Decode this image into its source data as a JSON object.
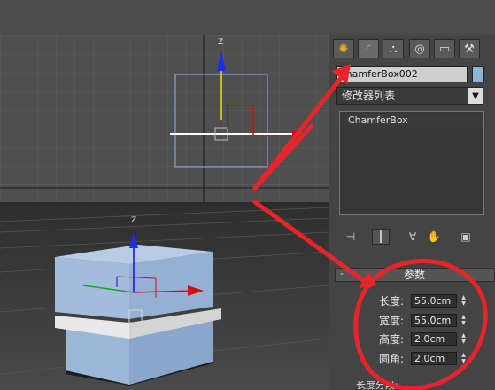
{
  "command_panel": {
    "tabs": [
      {
        "name": "create",
        "icon": "sun-icon",
        "glyph": "✺"
      },
      {
        "name": "modify",
        "icon": "modify-arc-icon",
        "glyph": "◜"
      },
      {
        "name": "hierarchy",
        "icon": "hierarchy-icon",
        "glyph": "⛬"
      },
      {
        "name": "motion",
        "icon": "motion-icon",
        "glyph": "◎"
      },
      {
        "name": "display",
        "icon": "display-icon",
        "glyph": "▭"
      },
      {
        "name": "utilities",
        "icon": "hammer-icon",
        "glyph": "⚒"
      }
    ],
    "object_name": "ChamferBox002",
    "object_color": "#8fb4d8",
    "modifier_list_label": "修改器列表",
    "modifier_stack": [
      "ChamferBox"
    ],
    "stack_tool_glyphs": [
      "⊣",
      "┃",
      "∀",
      "✋",
      "▣"
    ]
  },
  "parameters": {
    "title": "参数",
    "collapse_glyph": "-",
    "fields": [
      {
        "label": "长度:",
        "value": "55.0cm"
      },
      {
        "label": "宽度:",
        "value": "55.0cm"
      },
      {
        "label": "高度:",
        "value": "2.0cm"
      },
      {
        "label": "圆角:",
        "value": "2.0cm"
      }
    ],
    "cut_off_label": "长度分段:"
  },
  "viewport_top": {
    "axis_label": "Z"
  },
  "viewport_persp": {
    "axis_label": "Z"
  },
  "annotation_color": "#e8242b"
}
